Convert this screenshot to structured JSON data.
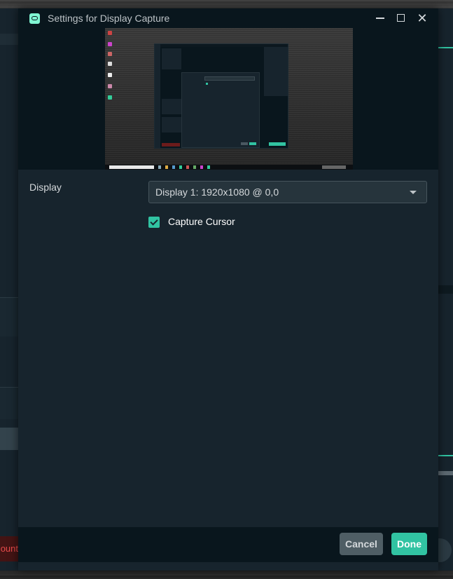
{
  "window": {
    "title": "Settings for Display Capture",
    "minimize_glyph": "",
    "maximize_glyph": "",
    "close_glyph": "✕"
  },
  "background_app": {
    "account_label_fragment": "ount"
  },
  "form": {
    "display_label": "Display",
    "display_value": "Display 1: 1920x1080 @ 0,0",
    "capture_cursor_label": "Capture Cursor",
    "capture_cursor_checked": true
  },
  "footer": {
    "cancel_label": "Cancel",
    "done_label": "Done"
  },
  "colors": {
    "accent": "#31c3a2",
    "dialog_bg": "#17242d",
    "titlebar_bg": "#09161d",
    "cancel_bg": "#4f5e65"
  }
}
